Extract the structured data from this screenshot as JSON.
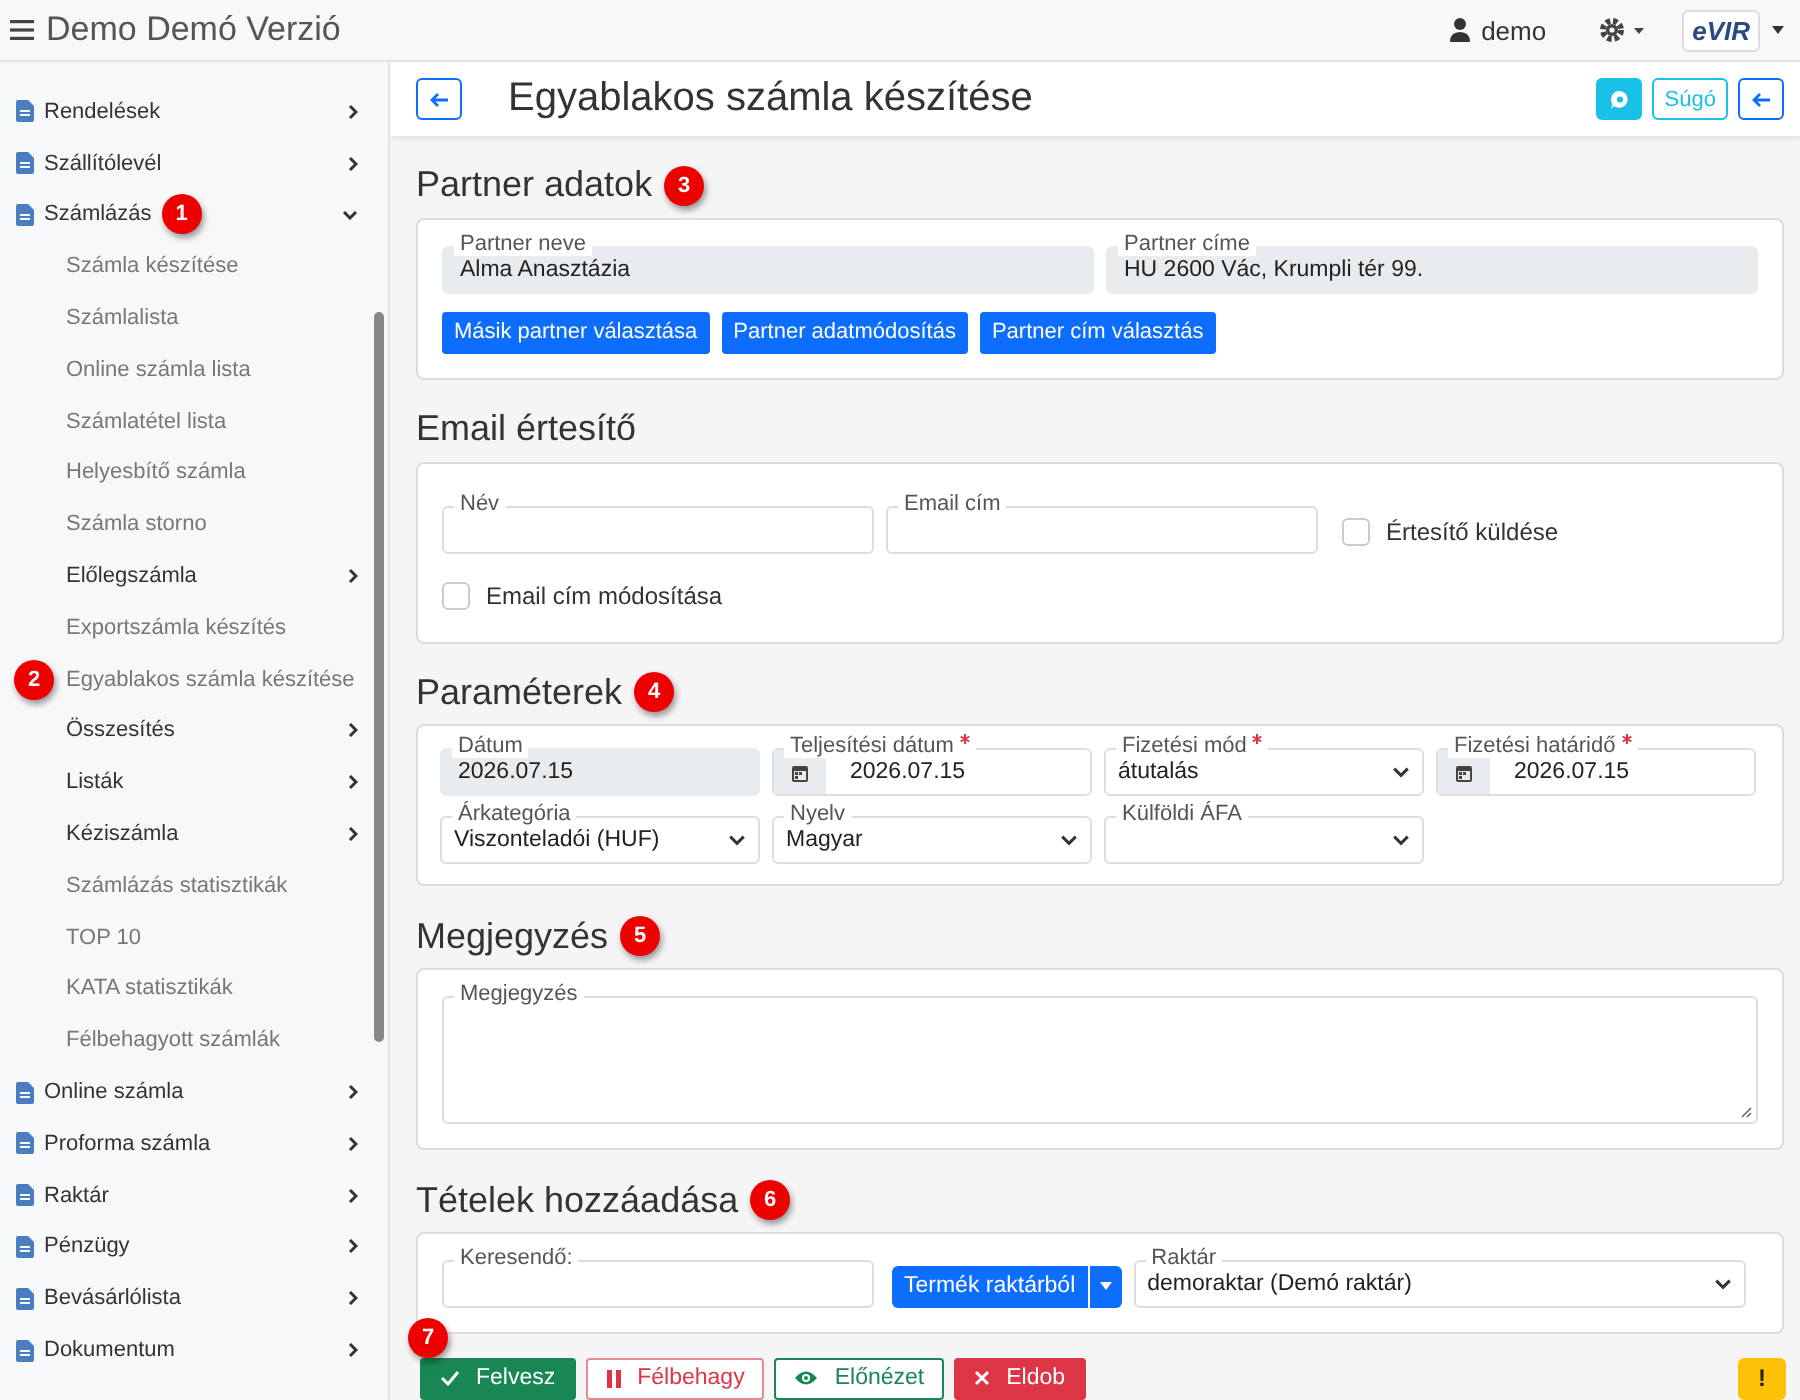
{
  "header": {
    "title": "Demo Demó Verzió",
    "user": "demo",
    "logo": "eVIR"
  },
  "sidebar": {
    "items": [
      {
        "label": "Rendelések",
        "expanded": false
      },
      {
        "label": "Szállítólevél",
        "expanded": false
      },
      {
        "label": "Számlázás",
        "expanded": true,
        "badge": "1",
        "children": [
          {
            "label": "Számla készítése",
            "kind": "link"
          },
          {
            "label": "Számlalista",
            "kind": "link"
          },
          {
            "label": "Online számla lista",
            "kind": "link"
          },
          {
            "label": "Számlatétel lista",
            "kind": "link"
          },
          {
            "label": "Helyesbítő számla",
            "kind": "link"
          },
          {
            "label": "Számla storno",
            "kind": "link"
          },
          {
            "label": "Előlegszámla",
            "kind": "group",
            "expanded": false
          },
          {
            "label": "Exportszámla készítés",
            "kind": "link"
          },
          {
            "label": "Egyablakos számla készítése",
            "kind": "link",
            "badge": "2"
          },
          {
            "label": "Összesítés",
            "kind": "group",
            "expanded": false
          },
          {
            "label": "Listák",
            "kind": "group",
            "expanded": false
          },
          {
            "label": "Kéziszámla",
            "kind": "group",
            "expanded": false
          },
          {
            "label": "Számlázás statisztikák",
            "kind": "link"
          },
          {
            "label": "TOP 10",
            "kind": "link"
          },
          {
            "label": "KATA statisztikák",
            "kind": "link"
          },
          {
            "label": "Félbehagyott számlák",
            "kind": "link"
          }
        ]
      },
      {
        "label": "Online számla",
        "expanded": false
      },
      {
        "label": "Proforma számla",
        "expanded": false
      },
      {
        "label": "Raktár",
        "expanded": false
      },
      {
        "label": "Pénzügy",
        "expanded": false
      },
      {
        "label": "Bevásárlólista",
        "expanded": false
      },
      {
        "label": "Dokumentum",
        "expanded": false
      }
    ]
  },
  "page": {
    "title": "Egyablakos számla készítése",
    "help_button": "Súgó"
  },
  "partner": {
    "title": "Partner adatok",
    "badge": "3",
    "fields": [
      {
        "label": "Partner neve",
        "value": "Alma Anasztázia"
      },
      {
        "label": "Partner címe",
        "value": "HU 2600 Vác, Krumpli tér 99."
      }
    ],
    "buttons": [
      "Másik partner választása",
      "Partner adatmódosítás",
      "Partner cím választás"
    ]
  },
  "email": {
    "title": "Email értesítő",
    "fields": [
      {
        "label": "Név"
      },
      {
        "label": "Email cím"
      }
    ],
    "checkboxes": [
      {
        "label": "Értesítő küldése",
        "checked": false
      },
      {
        "label": "Email cím módosítása",
        "checked": false
      }
    ]
  },
  "parameters": {
    "title": "Paraméterek",
    "badge": "4",
    "fields": [
      {
        "label": "Dátum",
        "value": "2026.07.15",
        "kind": "readonly",
        "required": false
      },
      {
        "label": "Teljesítési dátum",
        "value": "2026.07.15",
        "kind": "date",
        "required": true
      },
      {
        "label": "Fizetési mód",
        "value": "átutalás",
        "kind": "select",
        "required": true
      },
      {
        "label": "Fizetési határidő",
        "value": "2026.07.15",
        "kind": "date",
        "required": true
      },
      {
        "label": "Árkategória",
        "value": "Viszonteladói (HUF)",
        "kind": "select",
        "required": false
      },
      {
        "label": "Nyelv",
        "value": "Magyar",
        "kind": "select",
        "required": false
      },
      {
        "label": "Külföldi ÁFA",
        "kind": "select",
        "required": false
      }
    ]
  },
  "note": {
    "title": "Megjegyzés",
    "badge": "5",
    "field_label": "Megjegyzés"
  },
  "items": {
    "title": "Tételek hozzáadása",
    "badge": "6",
    "search_label": "Keresendő:",
    "source_button": "Termék raktárból",
    "warehouse_label": "Raktár",
    "warehouse_value": "demoraktar (Demó raktár)"
  },
  "actions": {
    "badge": "7",
    "buttons": [
      {
        "label": "Felvesz",
        "kind": "save"
      },
      {
        "label": "Félbehagy",
        "kind": "pause"
      },
      {
        "label": "Előnézet",
        "kind": "preview"
      },
      {
        "label": "Eldob",
        "kind": "discard"
      }
    ],
    "warning": "!"
  }
}
